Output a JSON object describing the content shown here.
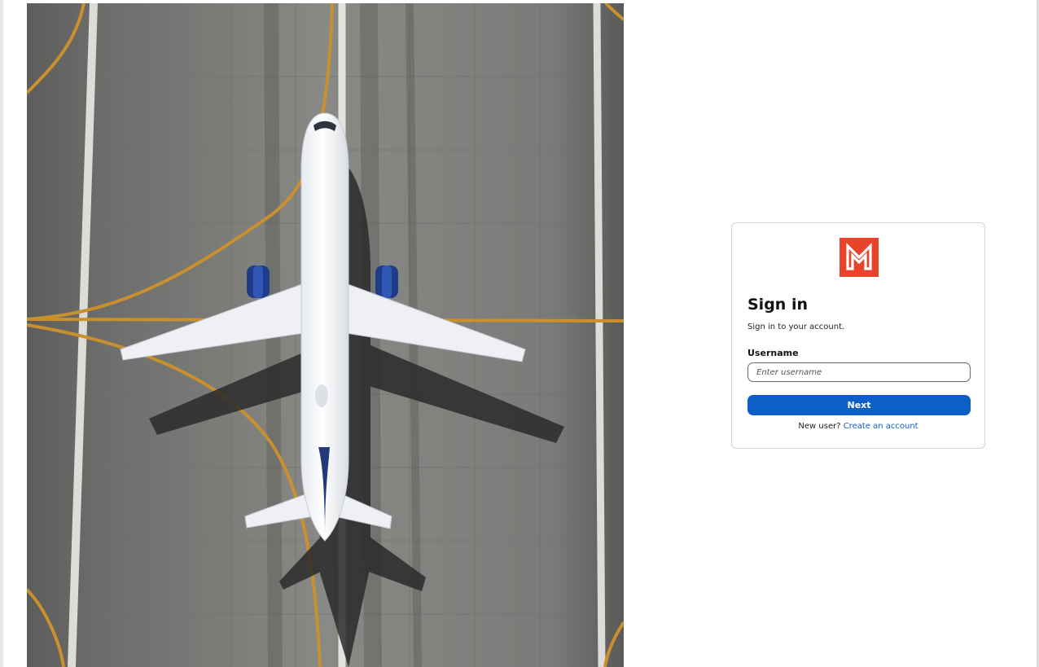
{
  "hero": {
    "image_name": "aerial-airplane-on-runway"
  },
  "logo": {
    "icon": "m-logo-icon",
    "color": "#e9432c"
  },
  "signin": {
    "title": "Sign in",
    "subtitle": "Sign in to your account.",
    "username_label": "Username",
    "username_placeholder": "Enter username",
    "username_value": "",
    "next_label": "Next",
    "new_user_text": "New user?",
    "create_account_label": "Create an account"
  },
  "colors": {
    "primary": "#0b5fc6",
    "brand": "#e9432c",
    "card_border": "#d0d4d9"
  }
}
